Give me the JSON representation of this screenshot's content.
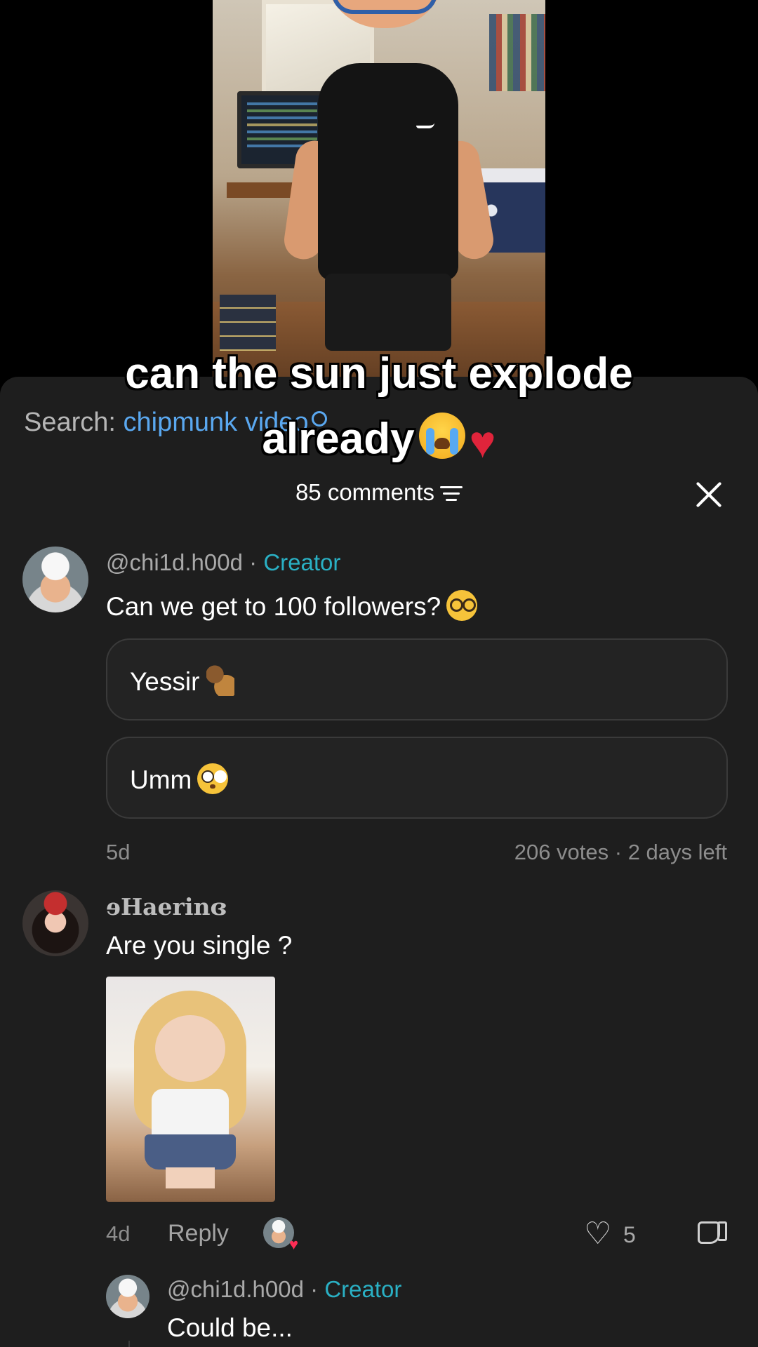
{
  "video": {
    "caption_line1": "can the sun just explode",
    "caption_line2": "already"
  },
  "search": {
    "label": "Search: ",
    "term": "chipmunk video"
  },
  "header": {
    "comments_count": "85 comments"
  },
  "comments": [
    {
      "username": "@chi1d.h00d",
      "badge": "Creator",
      "text": "Can we get to 100 followers?",
      "poll": {
        "options": [
          "Yessir",
          "Umm"
        ],
        "votes": "206 votes · 2 days left"
      },
      "time": "5d"
    },
    {
      "username": "ɘHaerinɞ",
      "text": "Are you single ?",
      "time": "4d",
      "reply_label": "Reply",
      "likes": "5"
    }
  ],
  "reply": {
    "username": "@chi1d.h00d",
    "badge": "Creator",
    "text": "Could be..."
  },
  "colors": {
    "sheet_bg": "#1e1e1e",
    "creator_badge": "#2ab0c4",
    "search_term": "#5aa8f0"
  }
}
